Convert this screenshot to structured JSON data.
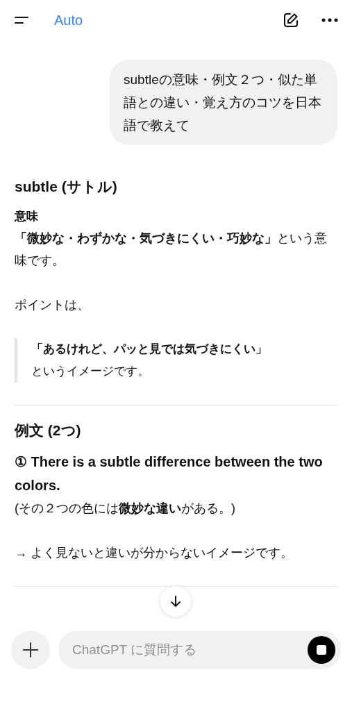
{
  "header": {
    "model": "Auto"
  },
  "user_message": {
    "text": "subtleの意味・例文２つ・似た単語との違い・覚え方のコツを日本語で教えて"
  },
  "answer": [
    {
      "kind": "heading",
      "text": "subtle (サトル)"
    },
    {
      "kind": "label",
      "text": "意味"
    },
    {
      "kind": "paragraph",
      "text": "**「微妙な・わずかな・気づきにくい・巧妙な」**という意味です。"
    },
    {
      "kind": "paragraph",
      "text": "ポイントは、"
    },
    {
      "kind": "quote",
      "lines": [
        "**「あるけれど、パッと見では気づきにくい」**",
        "というイメージです。"
      ]
    },
    {
      "kind": "divider"
    },
    {
      "kind": "heading",
      "text": "例文 (2つ)"
    },
    {
      "kind": "example",
      "text": "① There is a subtle difference between the two colors."
    },
    {
      "kind": "paragraph",
      "text": "(その２つの色には**微妙な違い**がある。)"
    },
    {
      "kind": "paragraph",
      "text": "→ よく見ないと違いが分からないイメージです。"
    },
    {
      "kind": "divider"
    }
  ],
  "composer": {
    "placeholder": "ChatGPT に質問する"
  }
}
